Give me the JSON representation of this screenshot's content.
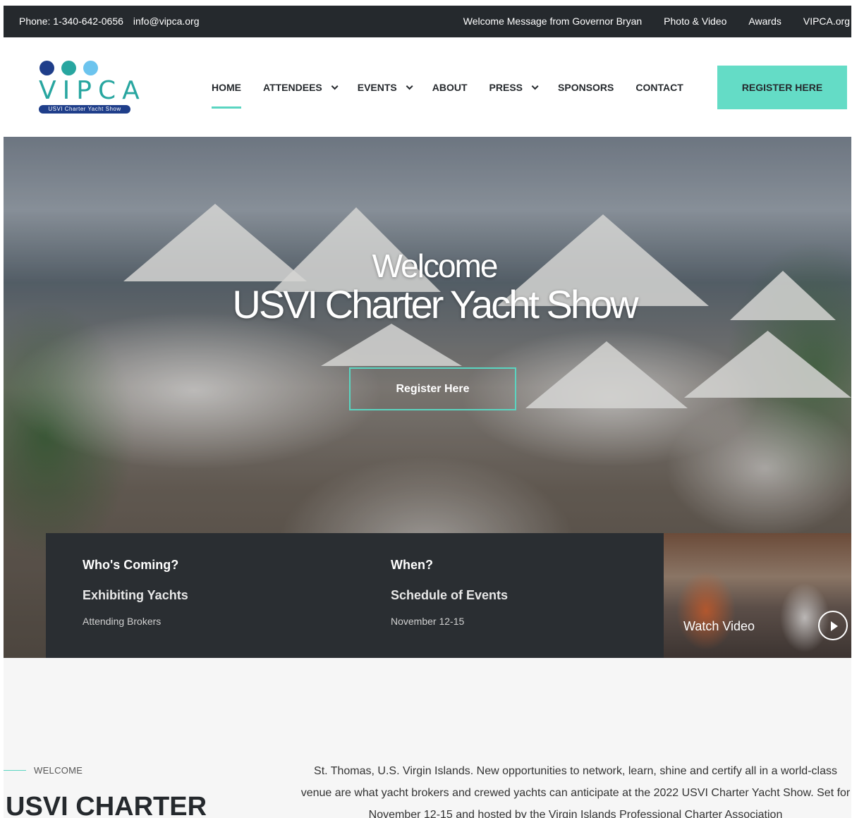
{
  "topbar": {
    "phone": "Phone: 1-340-642-0656",
    "email": "info@vipca.org",
    "links": [
      "Welcome Message from Governor Bryan",
      "Photo & Video",
      "Awards",
      "VIPCA.org"
    ]
  },
  "logo": {
    "text": "VIPCA",
    "tagline": "USVI Charter Yacht Show",
    "dot_colors": [
      "#1f3e8a",
      "#28a6a0",
      "#6cc4ee"
    ]
  },
  "nav": {
    "home": "HOME",
    "attendees": "ATTENDEES",
    "events": "EVENTS",
    "about": "ABOUT",
    "press": "PRESS",
    "sponsors": "SPONSORS",
    "contact": "CONTACT",
    "register": "REGISTER HERE"
  },
  "hero": {
    "title_line1": "Welcome",
    "title_line2": "USVI Charter Yacht Show",
    "cta": "Register Here"
  },
  "info": {
    "who": {
      "question": "Who's Coming?",
      "link": "Exhibiting Yachts",
      "sub": "Attending Brokers"
    },
    "when": {
      "question": "When?",
      "link": "Schedule of Events",
      "sub": "November 12-15"
    },
    "video_label": "Watch Video"
  },
  "welcome": {
    "kicker": "WELCOME",
    "heading": "USVI CHARTER",
    "paragraph": "St. Thomas, U.S. Virgin Islands. New opportunities to network, learn, shine and certify all in a world-class venue are what yacht brokers and crewed yachts can anticipate at the 2022 USVI Charter Yacht Show. Set for November 12-15 and hosted by the Virgin Islands Professional Charter Association"
  },
  "colors": {
    "accent": "#5ad5c1",
    "dark": "#25292d",
    "button": "#64dcc6"
  }
}
